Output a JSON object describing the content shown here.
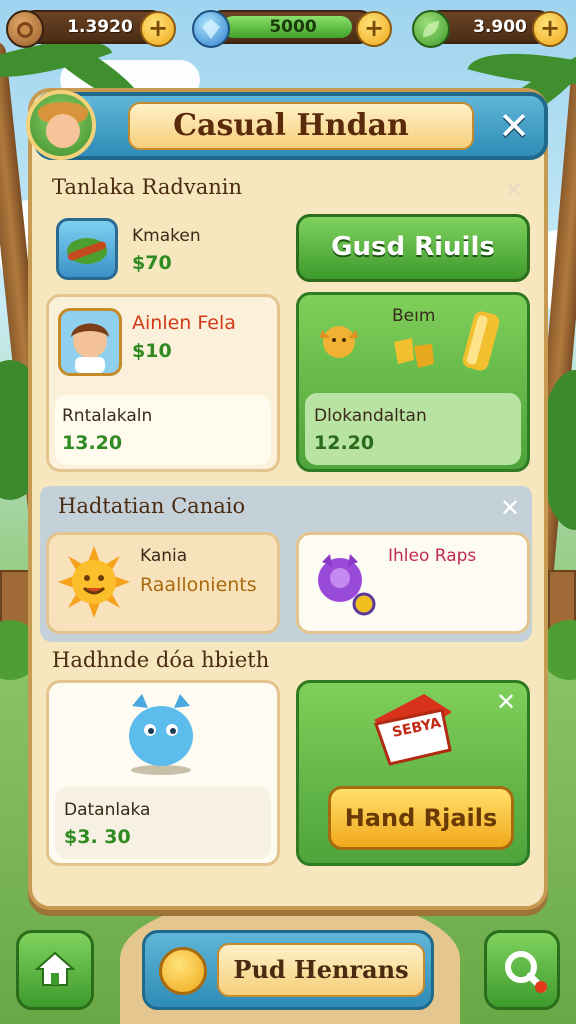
{
  "hud": {
    "coins": "1.3920",
    "gems": "5000",
    "leaves": "3.900",
    "plus_symbol": "+"
  },
  "header": {
    "title": "Casual Hndan",
    "close_symbol": "✕"
  },
  "section1": {
    "title": "Tanlaka Radvanin",
    "close_symbol": "✕",
    "item1": {
      "name": "Kmaken",
      "price": "$70"
    },
    "main_button": "Gusd Riuils",
    "card_left": {
      "name": "Ainlen Fela",
      "price": "$10",
      "sub_label": "Rntalakaln",
      "sub_price": "13.20"
    },
    "card_right": {
      "name": "Beım",
      "sub_label": "Dlokandaltan",
      "sub_price": "12.20"
    }
  },
  "section2": {
    "title": "Hadtatian Canaio",
    "close_symbol": "✕",
    "card_left": {
      "line1": "Kania",
      "line2": "Raallonients"
    },
    "card_right": {
      "name": "Ihleo Raps"
    }
  },
  "section3": {
    "title": "Hadhnde dóa hbieth",
    "card_left": {
      "label": "Datanlaka",
      "price": "$3. 30"
    },
    "card_right": {
      "badge": "SEBYA",
      "button": "Hand Rjails",
      "close_symbol": "✕"
    }
  },
  "bottom": {
    "main_button": "Pud Henrans"
  },
  "colors": {
    "accent_blue": "#2f8cb6",
    "accent_green": "#4ea33a",
    "panel_bg": "#f6e7bf",
    "gold": "#f2a81c"
  }
}
